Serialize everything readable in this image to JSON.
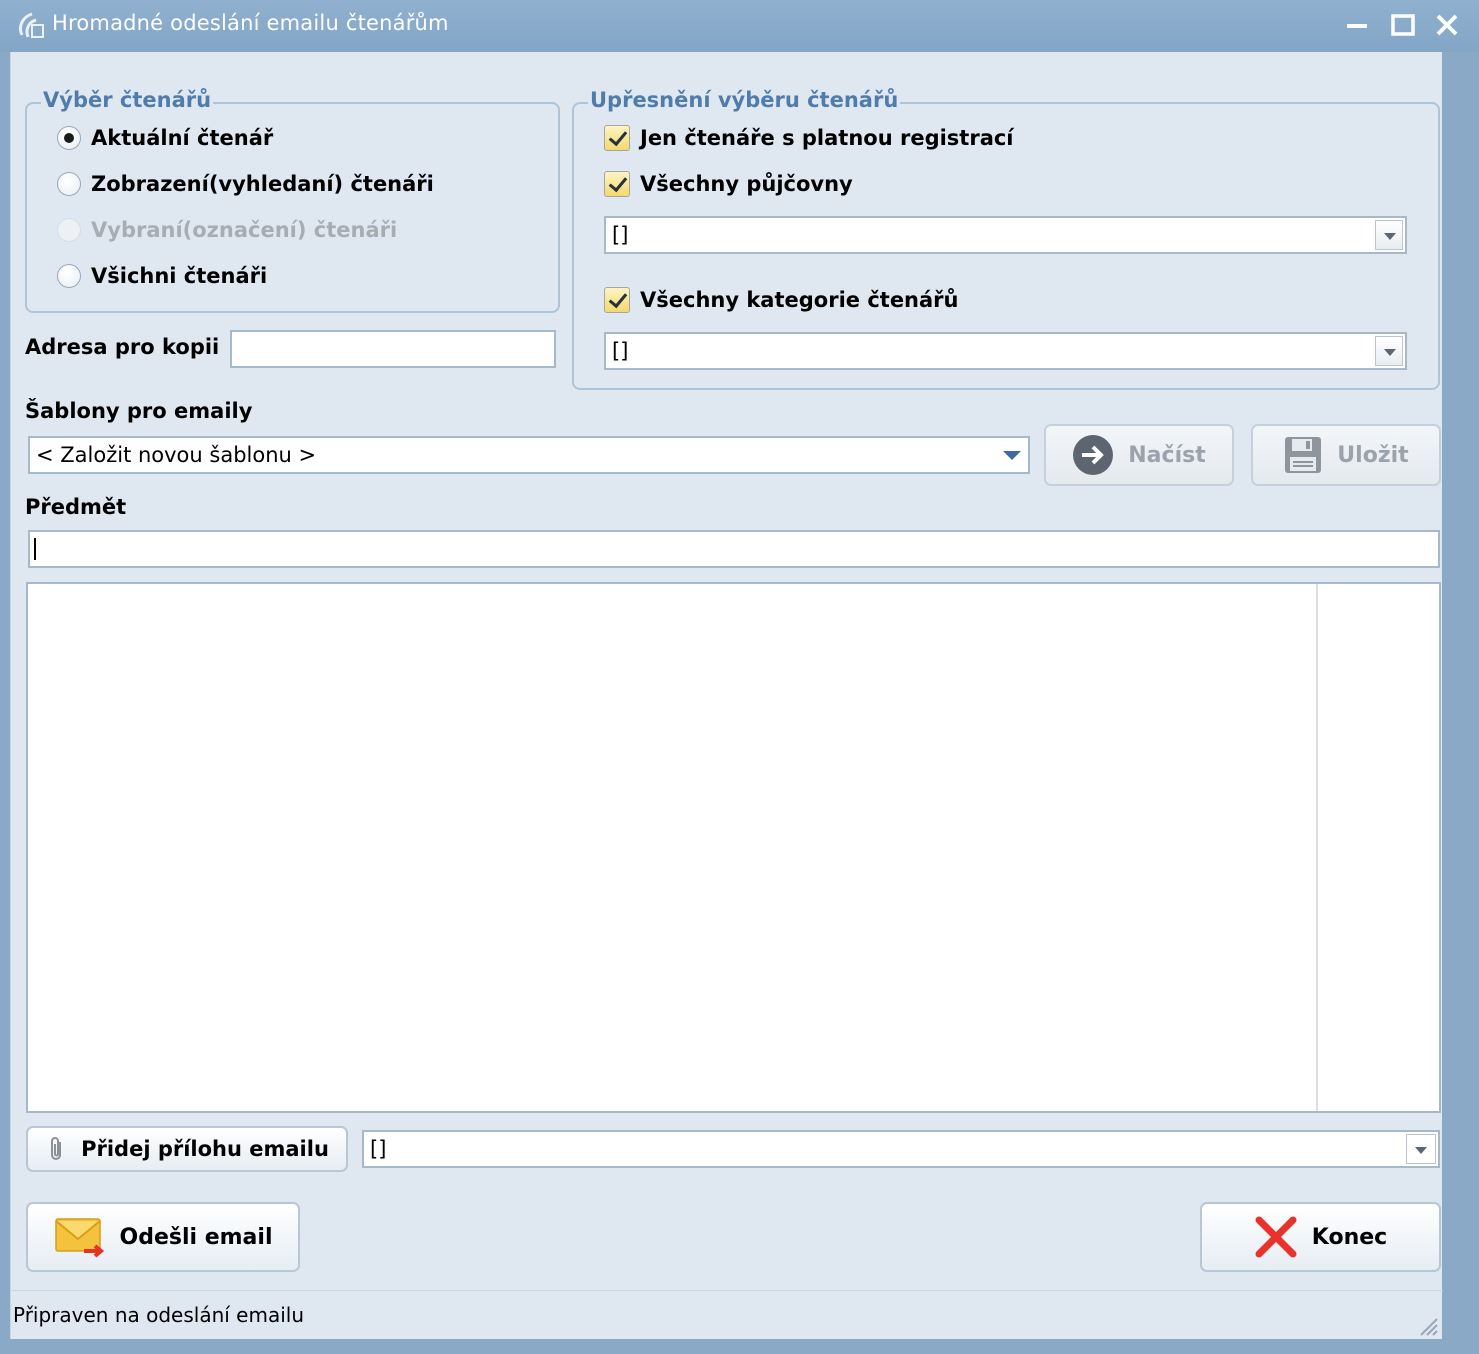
{
  "window": {
    "title": "Hromadné odeslání emailu čtenářům"
  },
  "reader_selection": {
    "title": "Výběr čtenářů",
    "options": [
      {
        "label": "Aktuální čtenář",
        "checked": true,
        "enabled": true
      },
      {
        "label": "Zobrazení(vyhledaní) čtenáři",
        "checked": false,
        "enabled": true
      },
      {
        "label": "Vybraní(označení) čtenáři",
        "checked": false,
        "enabled": false
      },
      {
        "label": "Všichni čtenáři",
        "checked": false,
        "enabled": true
      }
    ]
  },
  "refinement": {
    "title": "Upřesnění výběru čtenářů",
    "valid_registration_label": "Jen čtenáře s platnou registrací",
    "all_branches_label": "Všechny půjčovny",
    "branches_value": "[]",
    "all_categories_label": "Všechny kategorie čtenářů",
    "categories_value": "[]"
  },
  "copy_address": {
    "label": "Adresa pro kopii",
    "value": ""
  },
  "templates": {
    "label": "Šablony pro emaily",
    "selected": "< Založit novou šablonu >",
    "load_label": "Načíst",
    "save_label": "Uložit"
  },
  "subject": {
    "label": "Předmět",
    "value": ""
  },
  "attachment": {
    "button_label": "Přidej přílohu emailu",
    "value": "[]"
  },
  "actions": {
    "send_label": "Odešli email",
    "close_label": "Konec"
  },
  "status": {
    "text": "Připraven na odeslání emailu"
  },
  "colors": {
    "titlebar": "#89a9c7",
    "background": "#dfe8f1",
    "group_title": "#4f7cab",
    "close_icon": "#e8322b"
  }
}
